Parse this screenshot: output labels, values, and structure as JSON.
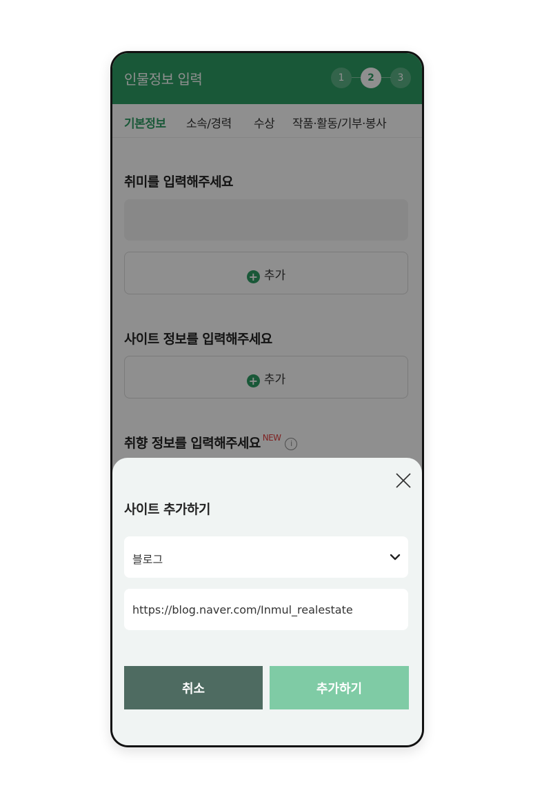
{
  "header": {
    "title": "인물정보 입력",
    "steps": [
      "1",
      "2",
      "3"
    ]
  },
  "tabs": [
    "기본정보",
    "소속/경력",
    "수상",
    "작품·활동/기부·봉사"
  ],
  "hobby": {
    "title": "취미를 입력해주세요",
    "add_label": "추가"
  },
  "site": {
    "title": "사이트 정보를 입력해주세요",
    "add_label": "추가"
  },
  "taste": {
    "title": "취향 정보를 입력해주세요",
    "badge": "NEW",
    "info_icon": "i"
  },
  "modal": {
    "title": "사이트 추가하기",
    "site_type": "블로그",
    "url_value": "https://blog.naver.com/Inmul_realestate",
    "cancel_label": "취소",
    "confirm_label": "추가하기"
  },
  "colors": {
    "brand_green": "#2e9e64",
    "cancel_button": "#4e6b61",
    "confirm_button": "#7fcba5"
  }
}
